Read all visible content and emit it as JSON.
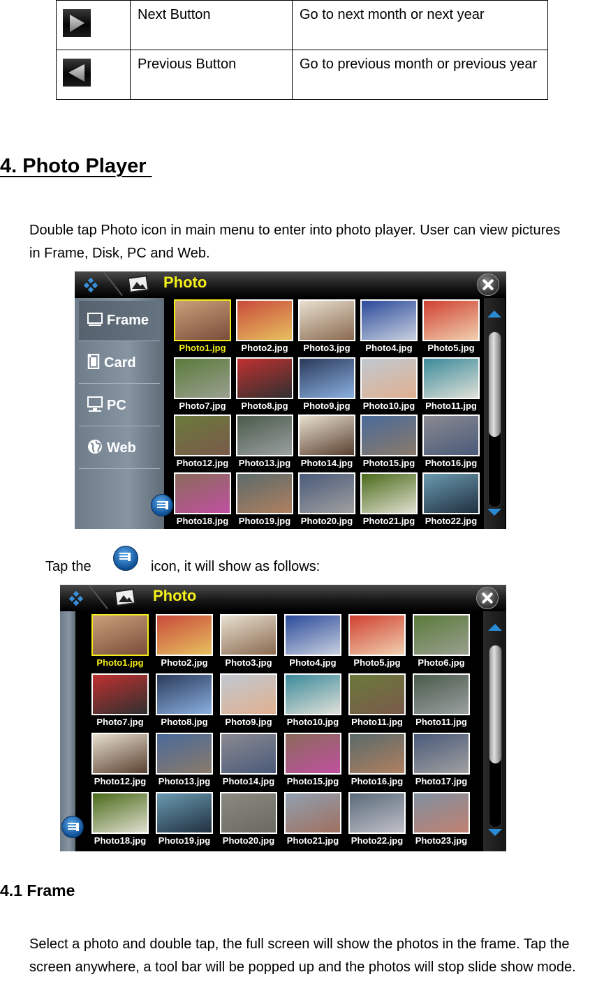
{
  "button_table": {
    "rows": [
      {
        "icon": "next-arrow-icon",
        "name": "Next Button",
        "description": "Go to next month or next year"
      },
      {
        "icon": "previous-arrow-icon",
        "name": "Previous Button",
        "description": "Go to previous month or previous year"
      }
    ]
  },
  "section": {
    "heading": "4. Photo Player ",
    "intro": "Double tap Photo icon in main menu to enter into photo player. User can view pictures in Frame, Disk, PC and Web.",
    "tap_before": "Tap the",
    "tap_after": "icon, it will show as follows:"
  },
  "screen1": {
    "title": "Photo",
    "sidebar": [
      {
        "label": "Frame",
        "icon": "frame-icon",
        "selected": true
      },
      {
        "label": "Card",
        "icon": "card-icon",
        "selected": false
      },
      {
        "label": "PC",
        "icon": "pc-icon",
        "selected": false
      },
      {
        "label": "Web",
        "icon": "globe-icon",
        "selected": false
      }
    ],
    "photos": [
      "Photo1.jpg",
      "Photo2.jpg",
      "Photo3.jpg",
      "Photo4.jpg",
      "Photo5.jpg",
      "Photo7.jpg",
      "Photo8.jpg",
      "Photo9.jpg",
      "Photo10.jpg",
      "Photo11.jpg",
      "Photo12.jpg",
      "Photo13.jpg",
      "Photo14.jpg",
      "Photo15.jpg",
      "Photo16.jpg",
      "Photo18.jpg",
      "Photo19.jpg",
      "Photo20.jpg",
      "Photo21.jpg",
      "Photo22.jpg"
    ],
    "selected_index": 0,
    "scroll_fraction": 0.6
  },
  "screen2": {
    "title": "Photo",
    "photos": [
      "Photo1.jpg",
      "Photo2.jpg",
      "Photo3.jpg",
      "Photo4.jpg",
      "Photo5.jpg",
      "Photo6.jpg",
      "Photo7.jpg",
      "Photo8.jpg",
      "Photo9.jpg",
      "Photo10.jpg",
      "Photo11.jpg",
      "Photo11.jpg",
      "Photo12.jpg",
      "Photo13.jpg",
      "Photo14.jpg",
      "Photo15.jpg",
      "Photo16.jpg",
      "Photo17.jpg",
      "Photo18.jpg",
      "Photo19.jpg",
      "Photo20.jpg",
      "Photo21.jpg",
      "Photo22.jpg",
      "Photo23.jpg"
    ],
    "selected_index": 0,
    "scroll_fraction": 0.65
  },
  "subsection": {
    "heading": "4.1 Frame",
    "body": "Select a photo and double tap, the full screen will show the photos in the frame. Tap the screen anywhere, a tool bar will be popped up and the photos will stop slide show mode."
  },
  "colors": {
    "title_yellow": "#f5ef1a",
    "selection": "#f2ec1a",
    "arrow_blue": "#2a8ad4"
  }
}
